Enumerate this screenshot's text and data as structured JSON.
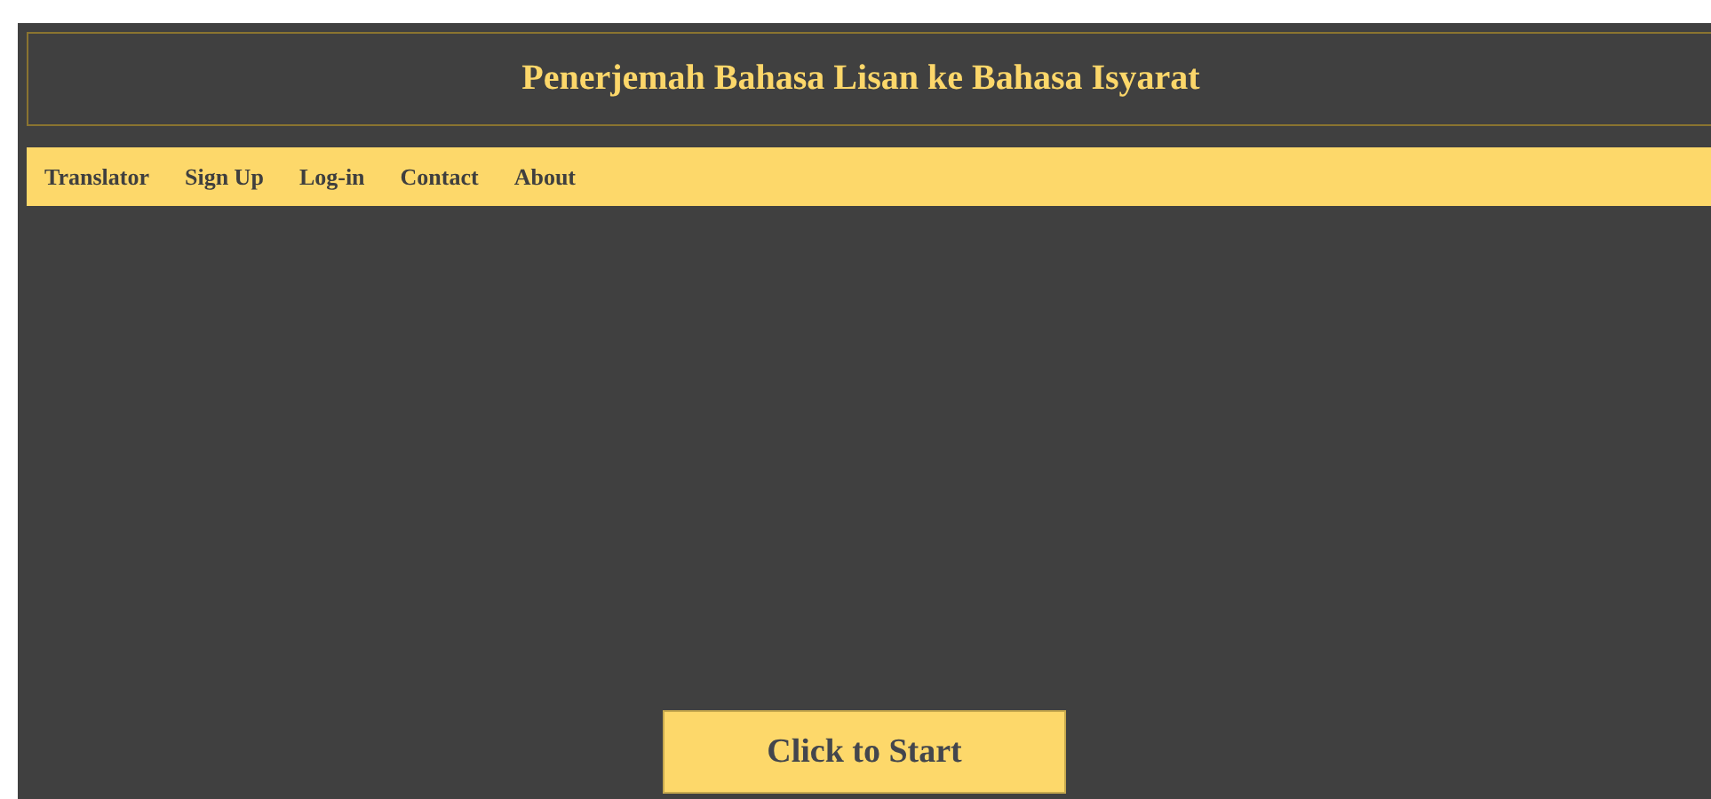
{
  "header": {
    "title": "Penerjemah Bahasa Lisan ke Bahasa Isyarat"
  },
  "nav": [
    {
      "label": "Translator"
    },
    {
      "label": "Sign Up"
    },
    {
      "label": "Log-in"
    },
    {
      "label": "Contact"
    },
    {
      "label": "About"
    }
  ],
  "start_button": {
    "label": "Click to Start"
  }
}
